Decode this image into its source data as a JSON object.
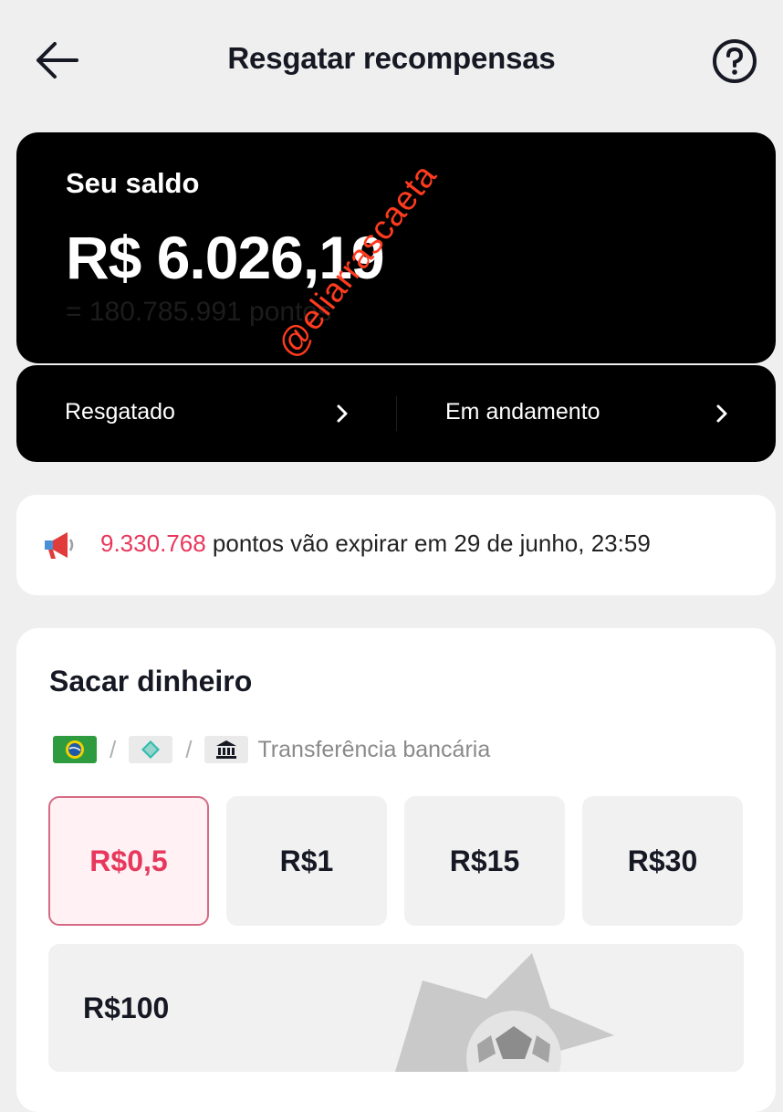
{
  "header": {
    "title": "Resgatar recompensas",
    "back_icon": "arrow-left-icon",
    "help_icon": "question-circle-icon"
  },
  "balance": {
    "label": "Seu saldo",
    "value": "R$ 6.026,19",
    "points_equivalent": "= 180.785.991 pontos"
  },
  "status_tabs": [
    {
      "label": "Resgatado"
    },
    {
      "label": "Em andamento"
    }
  ],
  "expiration": {
    "icon": "megaphone-icon",
    "points": "9.330.768",
    "text": " pontos vão expirar em 29 de junho, 23:59"
  },
  "withdraw": {
    "title": "Sacar dinheiro",
    "methods": [
      "pix-brazil-icon",
      "pix-icon",
      "bank-icon"
    ],
    "separator": "/",
    "bank_label": "Transferência bancária",
    "amounts": [
      "R$0,5",
      "R$1",
      "R$15",
      "R$30",
      "R$100"
    ],
    "selected_amount": "R$0,5"
  },
  "watermark": "@eliarrascaeta",
  "colors": {
    "background": "#efefef",
    "card_dark": "#000000",
    "accent": "#e8375c",
    "selected_bg": "#fff1f4",
    "watermark": "#ff3b1f"
  }
}
